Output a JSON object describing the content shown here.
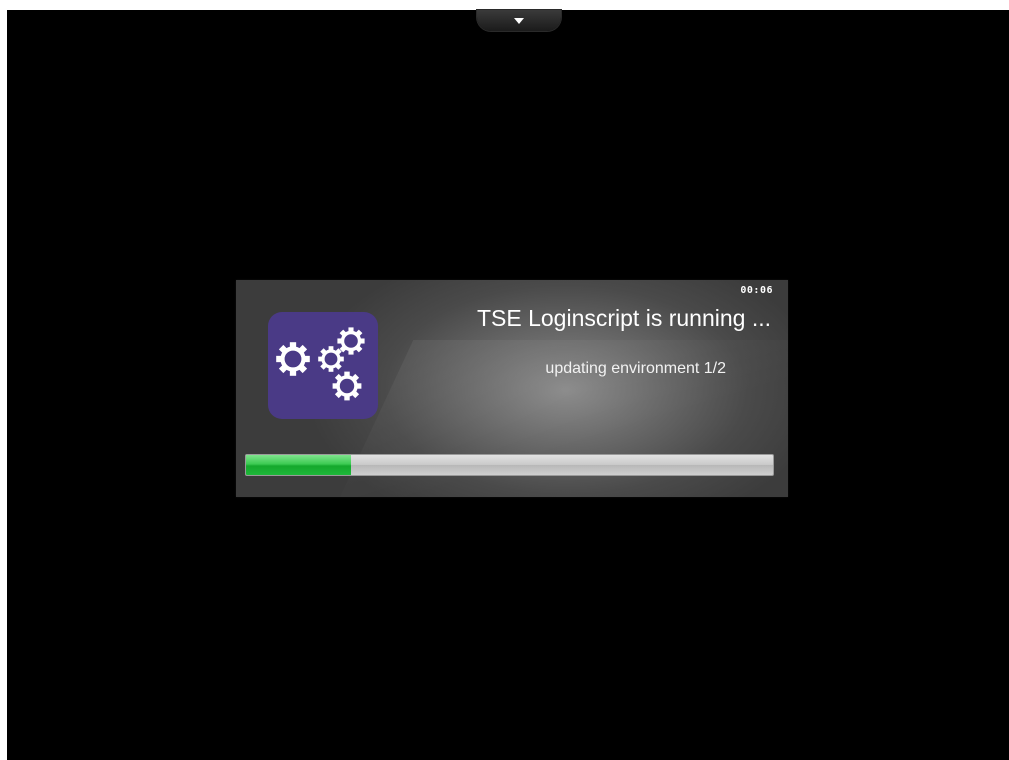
{
  "screen": {
    "background": "#000000",
    "top_tab_icon": "chevron-down-icon"
  },
  "dialog": {
    "timer": "00:06",
    "app_icon": "gears-icon",
    "app_icon_color": "#4a3a86",
    "title": "TSE Loginscript is running ...",
    "status": "updating environment 1/2",
    "progress": 0.2,
    "progress_color": "#2fc24a"
  }
}
